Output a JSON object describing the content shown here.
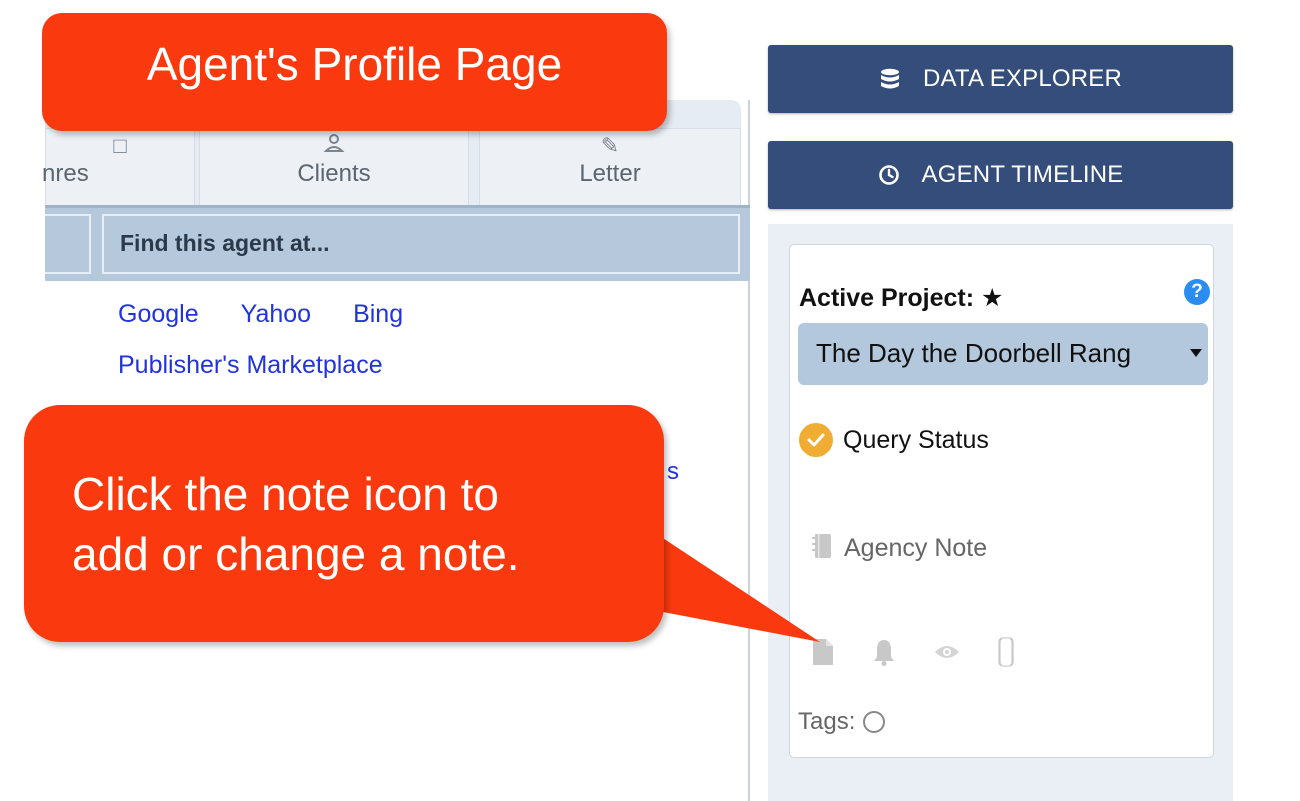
{
  "tabs": {
    "genres_label": "nres",
    "clients_label": "Clients",
    "letter_label": "Letter"
  },
  "find": {
    "header": "Find this agent at...",
    "links": [
      "Google",
      "Yahoo",
      "Bing"
    ],
    "marketplace": "Publisher's Marketplace",
    "peek_text": "s"
  },
  "buttons": {
    "data_explorer": "DATA EXPLORER",
    "agent_timeline": "AGENT TIMELINE"
  },
  "project": {
    "label": "Active Project: ★",
    "help": "?",
    "selected": "The Day the Doorbell Rang",
    "query_status": "Query Status",
    "agency_note": "Agency Note",
    "tags_label": "Tags:"
  },
  "callouts": {
    "title": "Agent's Profile Page",
    "note_line1": "Click the note icon to",
    "note_line2": "add or change a note."
  },
  "colors": {
    "callout": "#fa3a0e",
    "button": "#354d7a",
    "link": "#2233dd",
    "check": "#f0ac33",
    "help": "#2b8cf1"
  }
}
